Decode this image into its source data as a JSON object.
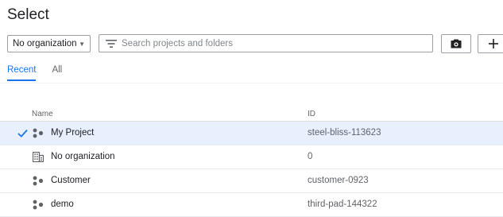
{
  "header": {
    "title": "Select"
  },
  "toolbar": {
    "org_select": "No organization",
    "search_placeholder": "Search projects and folders"
  },
  "tabs": [
    {
      "label": "Recent",
      "active": true
    },
    {
      "label": "All",
      "active": false
    }
  ],
  "table": {
    "columns": [
      "Name",
      "ID"
    ],
    "rows": [
      {
        "name": "My Project",
        "id": "steel-bliss-113623",
        "type": "project",
        "selected": true
      },
      {
        "name": "No organization",
        "id": "0",
        "type": "organization",
        "selected": false
      },
      {
        "name": "Customer",
        "id": "customer-0923",
        "type": "project",
        "selected": false
      },
      {
        "name": "demo",
        "id": "third-pad-144322",
        "type": "project",
        "selected": false
      }
    ]
  },
  "colors": {
    "accent": "#1a73e8",
    "selected_row": "#e8f0fe",
    "border": "#9aa0a6"
  },
  "icons": {
    "dropdown": "caret-down-icon",
    "search": "filter-icon",
    "camera": "camera-icon",
    "add": "plus-icon",
    "project": "project-icon",
    "organization": "organization-icon",
    "selected": "checkmark-icon"
  }
}
